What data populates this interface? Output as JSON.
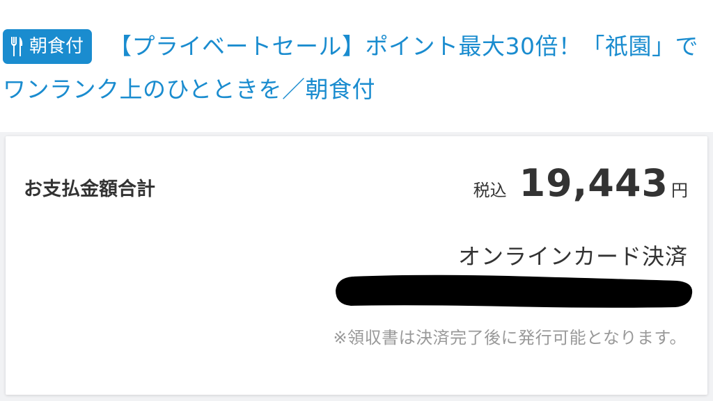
{
  "plan": {
    "badge_label": "朝食付",
    "badge_icon": "fork-knife-icon",
    "title": "【プライベートセール】ポイント最大30倍！「祇園」でワンランク上のひとときを／朝食付",
    "accent_color": "#1a8ccf"
  },
  "payment": {
    "total_label": "お支払金額合計",
    "tax_label": "税込",
    "amount": "19,443",
    "currency": "円",
    "method": "オンラインカード決済",
    "receipt_note": "※領収書は決済完了後に発行可能となります。"
  }
}
